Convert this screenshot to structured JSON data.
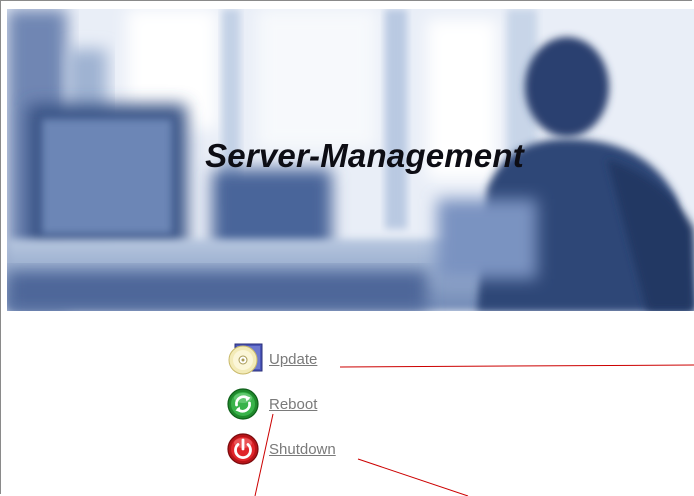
{
  "banner": {
    "title": "Server-Management"
  },
  "menu": {
    "items": [
      {
        "id": "update",
        "label": "Update",
        "icon": "cd-disc-icon"
      },
      {
        "id": "reboot",
        "label": "Reboot",
        "icon": "refresh-icon"
      },
      {
        "id": "shutdown",
        "label": "Shutdown",
        "icon": "power-icon"
      }
    ]
  },
  "colors": {
    "link": "#7a7a7a",
    "annotation_line": "#cc0000",
    "banner_blue": "#4f6fa8"
  }
}
